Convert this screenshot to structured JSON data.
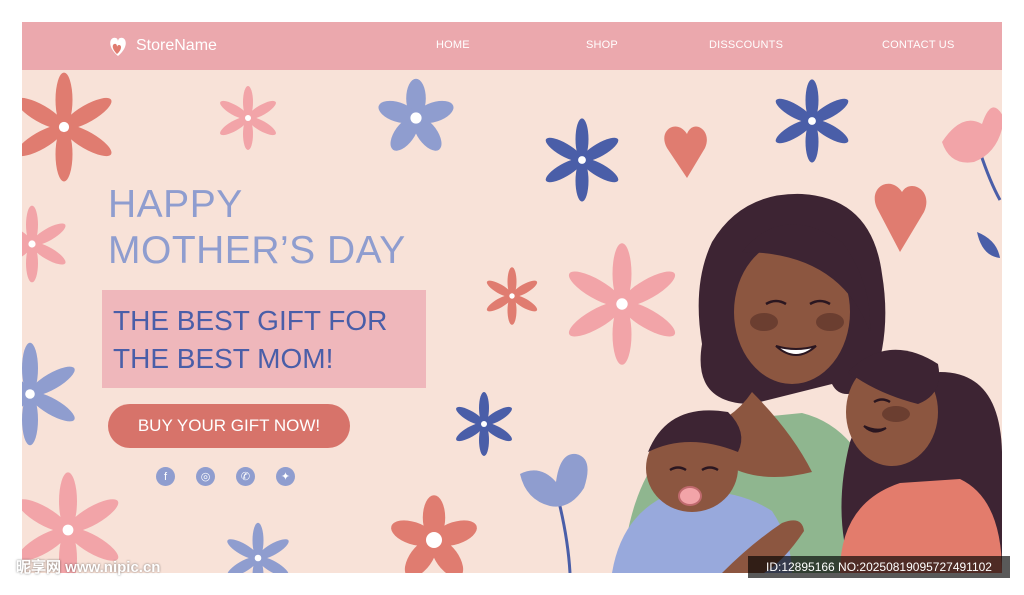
{
  "colors": {
    "nav_background": "#eba8ad",
    "page_background": "#f8e2d8",
    "headline": "#8f9dcf",
    "promo_background": "#efb7bb",
    "promo_text": "#4a5ea8",
    "cta_background": "#d7736a",
    "social_icon": "#8f9dcf"
  },
  "header": {
    "logo_icon": "heart-icon",
    "store_name": "StoreName",
    "nav": [
      "HOME",
      "SHOP",
      "DISSCOUNTS",
      "CONTACT US"
    ]
  },
  "hero": {
    "headline_line1": "HAPPY",
    "headline_line2": "MOTHER’S DAY",
    "promo_line1": "THE BEST GIFT FOR",
    "promo_line2": "THE BEST MOM!",
    "cta_label": "BUY YOUR GIFT NOW!",
    "social_icons": [
      "facebook-icon",
      "instagram-icon",
      "whatsapp-icon",
      "twitter-icon"
    ],
    "social_glyphs": [
      "f",
      "◎",
      "✆",
      "✦"
    ]
  },
  "watermark": {
    "left": "昵享网 www.nipic.cn",
    "right": "ID:12895166 NO:20250819095727491102"
  }
}
